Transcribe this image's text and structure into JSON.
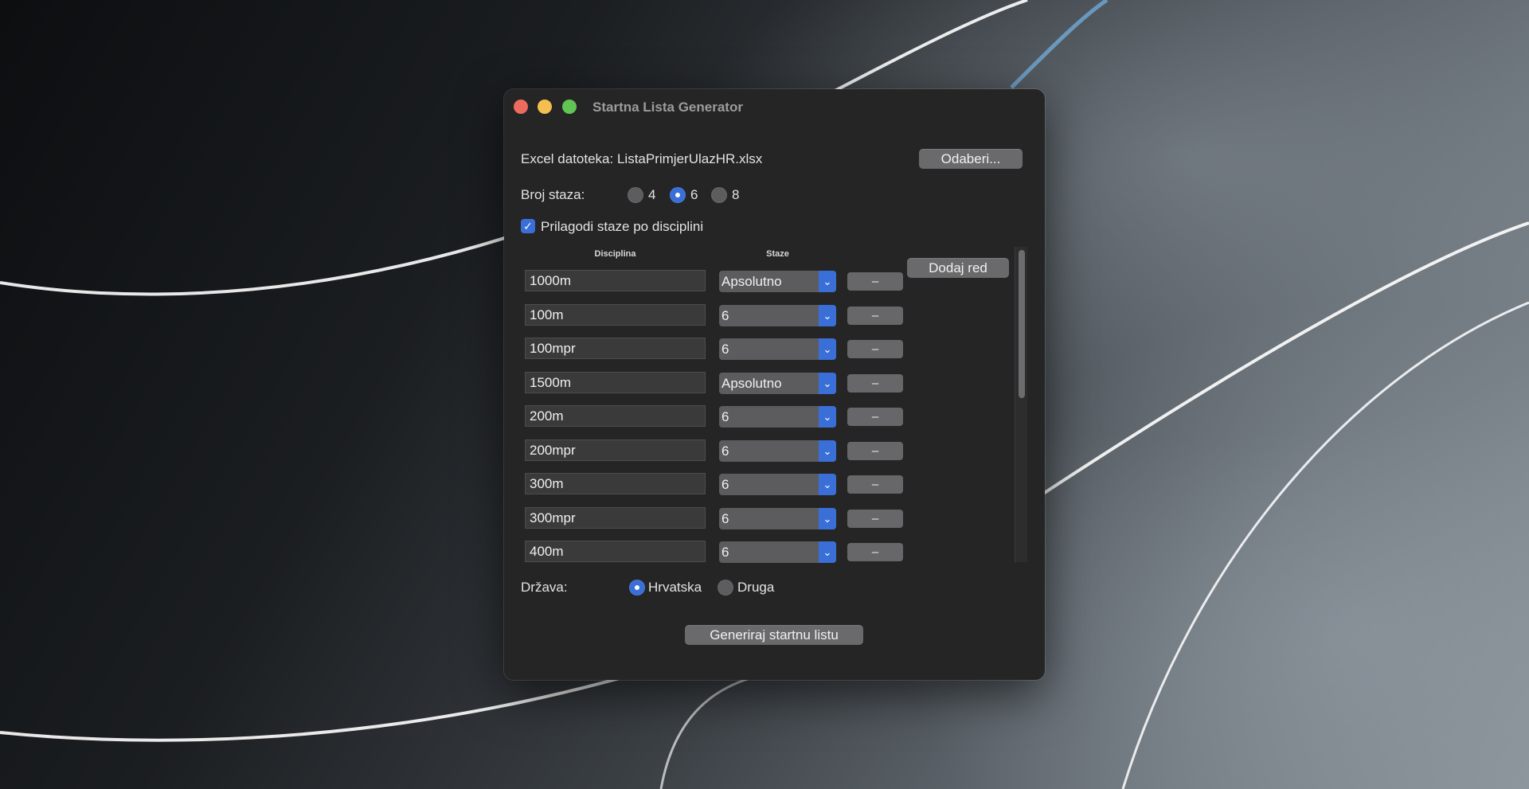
{
  "window": {
    "title": "Startna Lista Generator"
  },
  "file": {
    "label": "Excel datoteka: ListaPrimjerUlazHR.xlsx",
    "choose_button": "Odaberi..."
  },
  "lanes": {
    "label": "Broj staza:",
    "options": [
      "4",
      "6",
      "8"
    ],
    "selected": "6"
  },
  "adjust": {
    "label": "Prilagodi staze po disciplini",
    "checked": true
  },
  "table": {
    "col_discipline": "Disciplina",
    "col_lanes": "Staze",
    "add_row_button": "Dodaj red",
    "remove_label": "–",
    "rows": [
      {
        "discipline": "1000m",
        "lanes": "Apsolutno"
      },
      {
        "discipline": "100m",
        "lanes": "6"
      },
      {
        "discipline": "100mpr",
        "lanes": "6"
      },
      {
        "discipline": "1500m",
        "lanes": "Apsolutno"
      },
      {
        "discipline": "200m",
        "lanes": "6"
      },
      {
        "discipline": "200mpr",
        "lanes": "6"
      },
      {
        "discipline": "300m",
        "lanes": "6"
      },
      {
        "discipline": "300mpr",
        "lanes": "6"
      },
      {
        "discipline": "400m",
        "lanes": "6"
      }
    ]
  },
  "country": {
    "label": "Država:",
    "options": [
      "Hrvatska",
      "Druga"
    ],
    "selected": "Hrvatska"
  },
  "generate_button": "Generiraj startnu listu",
  "colors": {
    "accent": "#3a6fd8",
    "window_bg": "#252526",
    "close": "#ed6a5e",
    "minimize": "#f4bf4f",
    "maximize": "#61c554"
  }
}
